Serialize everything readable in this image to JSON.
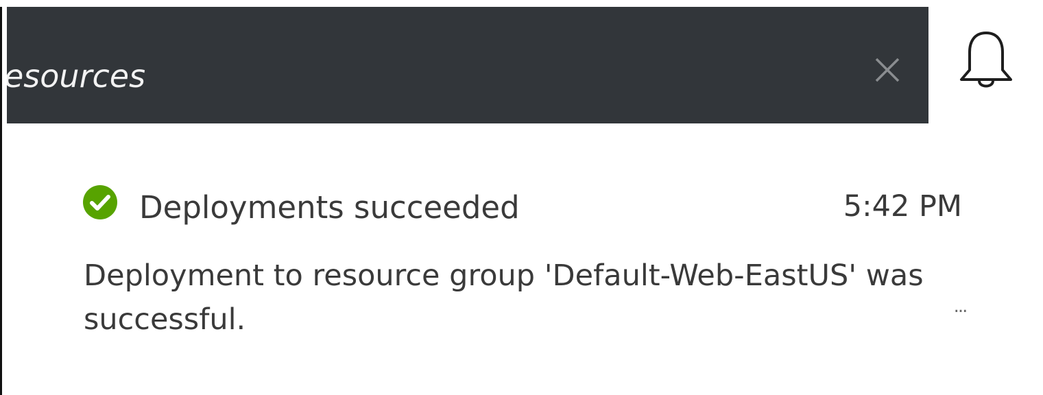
{
  "header": {
    "title": "esources",
    "close_icon": "close-icon",
    "bell_icon": "bell-icon",
    "bar_color": "#32363a"
  },
  "notification": {
    "status_icon": "success-check-icon",
    "status_color": "#57a300",
    "title": "Deployments succeeded",
    "time": "5:42 PM",
    "message": "Deployment to resource group 'Default-Web-EastUS' was successful.",
    "more_label": "..."
  }
}
